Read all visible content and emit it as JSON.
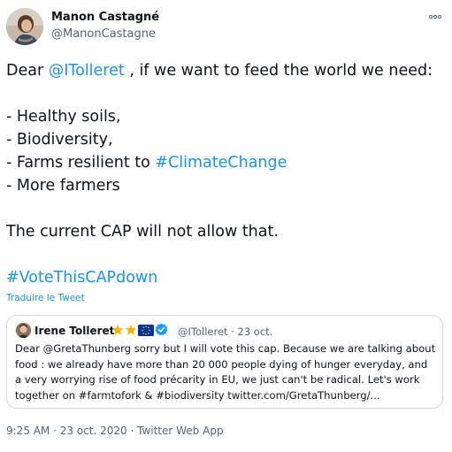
{
  "author": {
    "name": "Manon Castagné",
    "handle": "@ManonCastagne"
  },
  "tweet": {
    "line1": {
      "prefix": "Dear ",
      "mention": "@ITolleret",
      "suffix": " , if we want to feed the world we need:"
    },
    "list": [
      "- Healthy soils,",
      "- Biodiversity,",
      "- Farms resilient to ",
      "- More farmers"
    ],
    "hashtag_climate": "#ClimateChange",
    "closing": "The current CAP will not allow that.",
    "hashtag_vote": "#VoteThisCAPdown"
  },
  "translate_label": "Traduire le Tweet",
  "quoted": {
    "name": "Irene Tolleret",
    "handle_date": "@ITolleret · 23 oct.",
    "text_lines": [
      "Dear @GretaThunberg sorry but I will vote this cap. Because we are talking about",
      "food : we already have more than 20 000 people dying of hunger everyday, and",
      "a very worrying rise of food précarity in EU, we just can't be radical. Let's work",
      "together on #farmtofork & #biodiversity twitter.com/GretaThunberg/..."
    ],
    "badges": [
      "star-icon",
      "star-icon",
      "eu-flag-icon",
      "verified-icon"
    ]
  },
  "meta": "9:25 AM · 23 oct. 2020 · Twitter Web App",
  "colors": {
    "link": "#1b95e0",
    "secondary": "#536471",
    "border": "#cfd9de",
    "verified": "#1d9bf0",
    "star": "#f5b400",
    "eu_blue": "#003399"
  }
}
